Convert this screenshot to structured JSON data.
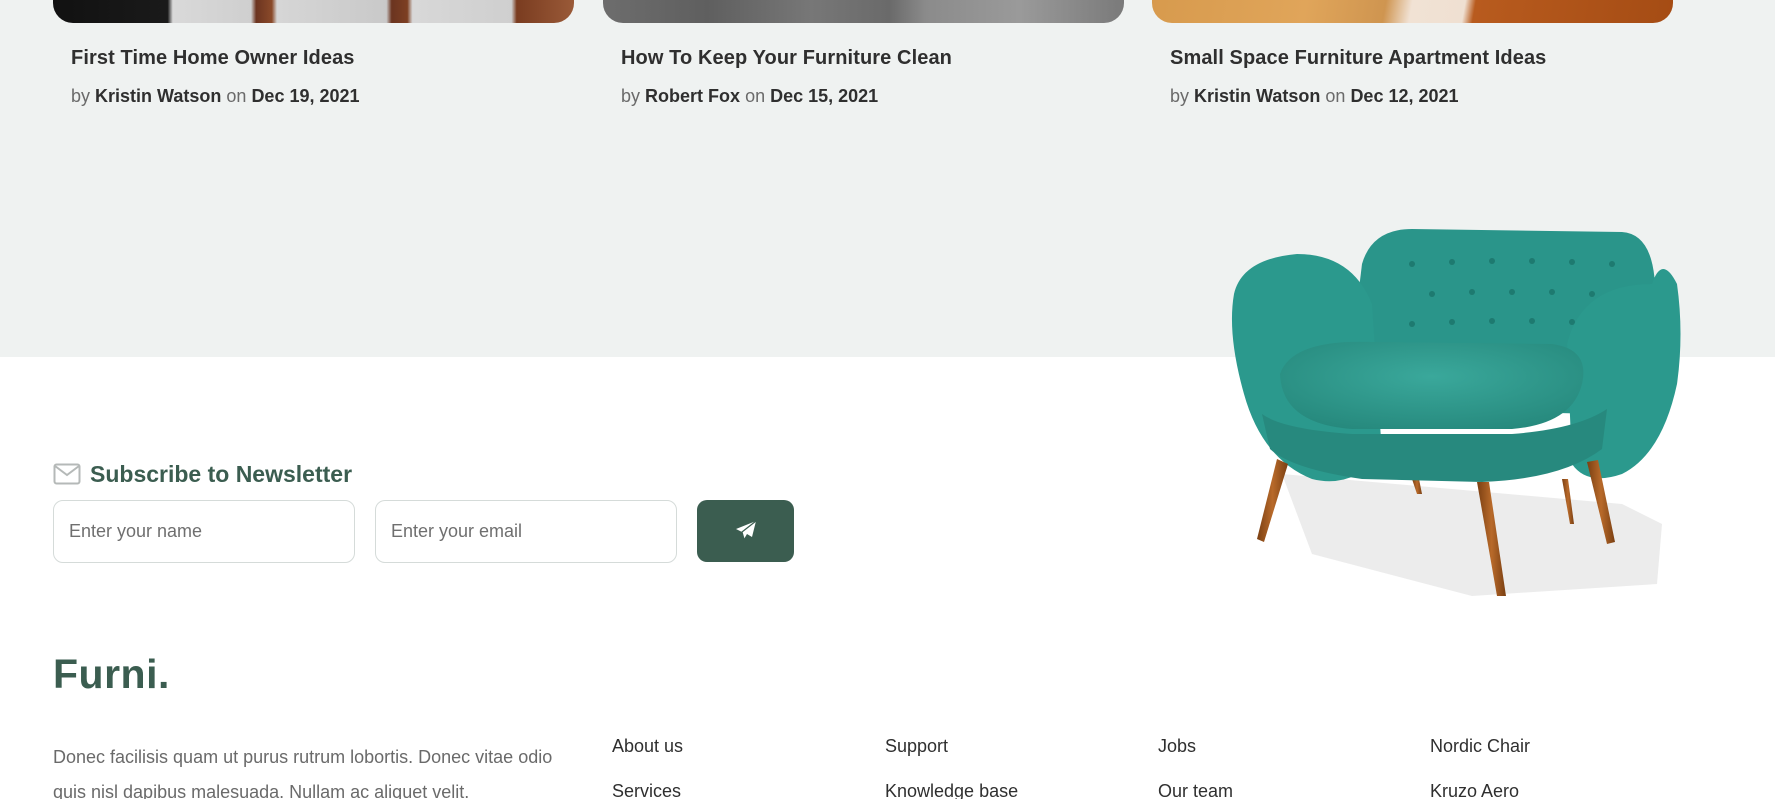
{
  "blog": {
    "posts": [
      {
        "title": "First Time Home Owner Ideas",
        "by_label": "by",
        "author": "Kristin Watson",
        "on_label": "on",
        "date": "Dec 19, 2021"
      },
      {
        "title": "How To Keep Your Furniture Clean",
        "by_label": "by",
        "author": "Robert Fox",
        "on_label": "on",
        "date": "Dec 15, 2021"
      },
      {
        "title": "Small Space Furniture Apartment Ideas",
        "by_label": "by",
        "author": "Kristin Watson",
        "on_label": "on",
        "date": "Dec 12, 2021"
      }
    ]
  },
  "newsletter": {
    "icon": "envelope-icon",
    "title": "Subscribe to Newsletter",
    "name_placeholder": "Enter your name",
    "email_placeholder": "Enter your email",
    "submit_icon": "paper-plane-icon"
  },
  "footer": {
    "brand": "Furni.",
    "about": "Donec facilisis quam ut purus rutrum lobortis. Donec vitae odio quis nisl dapibus malesuada. Nullam ac aliquet velit.",
    "columns": [
      [
        "About us",
        "Services"
      ],
      [
        "Support",
        "Knowledge base"
      ],
      [
        "Jobs",
        "Our team"
      ],
      [
        "Nordic Chair",
        "Kruzo Aero"
      ]
    ]
  },
  "colors": {
    "brand_green": "#3b5d50",
    "section_bg": "#eff2f1",
    "chair_teal": "#2f9e91",
    "text_dark": "#2f2f2f",
    "text_muted": "#6a6a6a"
  }
}
